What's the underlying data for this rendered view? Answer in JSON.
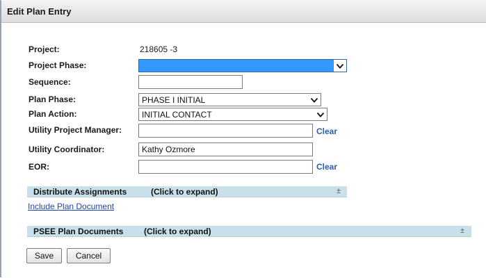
{
  "window": {
    "title": "Edit Plan Entry"
  },
  "form": {
    "project_label": "Project:",
    "project_value": "218605  -3",
    "project_phase_label": "Project Phase:",
    "project_phase_value": "",
    "sequence_label": "Sequence:",
    "sequence_value": "",
    "plan_phase_label": "Plan Phase:",
    "plan_phase_value": "PHASE I INITIAL",
    "plan_action_label": "Plan Action:",
    "plan_action_value": "INITIAL CONTACT",
    "upm_label": "Utility Project Manager:",
    "upm_value": "",
    "upm_clear": "Clear",
    "coordinator_label": "Utility Coordinator:",
    "coordinator_value": "Kathy Ozmore",
    "eor_label": "EOR:",
    "eor_value": "",
    "eor_clear": "Clear"
  },
  "sections": {
    "distribute": {
      "title": "Distribute Assignments",
      "hint": "(Click to expand)",
      "toggle": "±"
    },
    "include_link": "Include Plan Document",
    "psee": {
      "title": "PSEE Plan Documents",
      "hint": "(Click to expand)",
      "toggle": "±"
    }
  },
  "buttons": {
    "save": "Save",
    "cancel": "Cancel"
  },
  "icons": {
    "dropdown": "chevron-down-icon"
  },
  "colors": {
    "selected_highlight": "#3399ff",
    "section_bar": "#c9e0ea",
    "link": "#2244aa"
  }
}
